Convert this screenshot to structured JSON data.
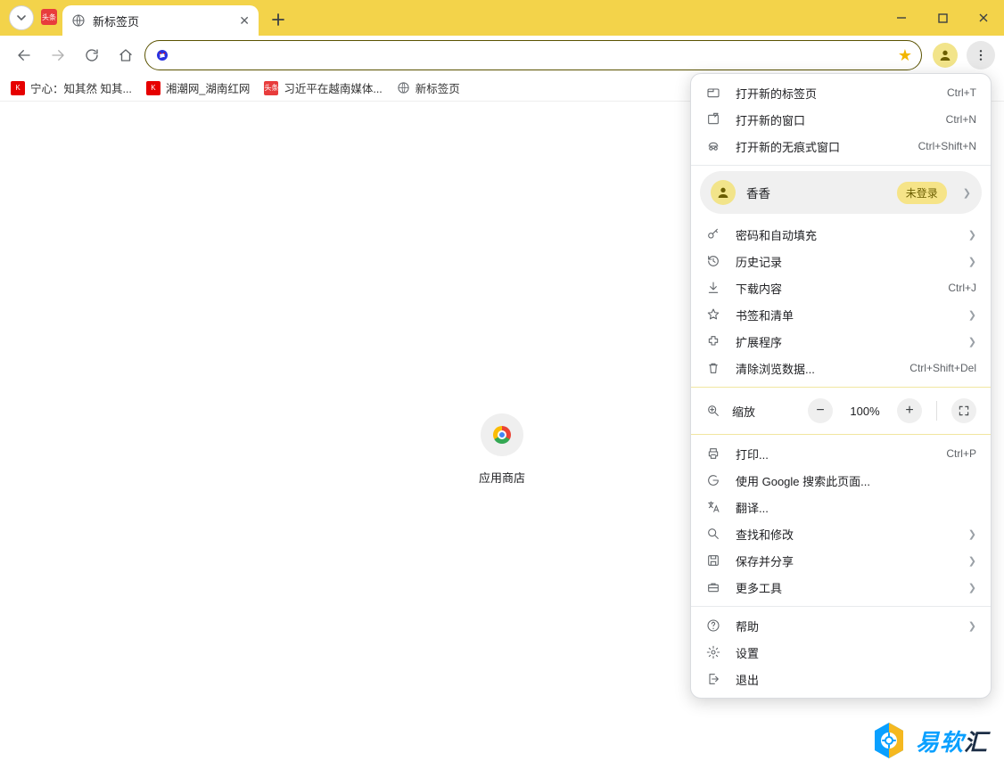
{
  "tab": {
    "title": "新标签页"
  },
  "bookmarks": [
    {
      "label": "宁心：知其然 知其..."
    },
    {
      "label": "湘潮网_湖南红网"
    },
    {
      "label": "习近平在越南媒体..."
    },
    {
      "label": "新标签页"
    }
  ],
  "shortcut": {
    "label": "应用商店"
  },
  "profile": {
    "name": "香香",
    "badge": "未登录"
  },
  "zoom": {
    "label": "缩放",
    "value": "100%"
  },
  "menu": {
    "new_tab": {
      "label": "打开新的标签页",
      "shortcut": "Ctrl+T"
    },
    "new_window": {
      "label": "打开新的窗口",
      "shortcut": "Ctrl+N"
    },
    "incognito": {
      "label": "打开新的无痕式窗口",
      "shortcut": "Ctrl+Shift+N"
    },
    "passwords": {
      "label": "密码和自动填充"
    },
    "history": {
      "label": "历史记录"
    },
    "downloads": {
      "label": "下载内容",
      "shortcut": "Ctrl+J"
    },
    "bookmarks": {
      "label": "书签和清单"
    },
    "extensions": {
      "label": "扩展程序"
    },
    "clear_data": {
      "label": "清除浏览数据...",
      "shortcut": "Ctrl+Shift+Del"
    },
    "print": {
      "label": "打印...",
      "shortcut": "Ctrl+P"
    },
    "google_search": {
      "label": "使用 Google 搜索此页面..."
    },
    "translate": {
      "label": "翻译..."
    },
    "find_edit": {
      "label": "查找和修改"
    },
    "save_share": {
      "label": "保存并分享"
    },
    "more_tools": {
      "label": "更多工具"
    },
    "help": {
      "label": "帮助"
    },
    "settings": {
      "label": "设置"
    },
    "exit": {
      "label": "退出"
    }
  },
  "watermark": {
    "a": "易软",
    "b": "汇"
  }
}
